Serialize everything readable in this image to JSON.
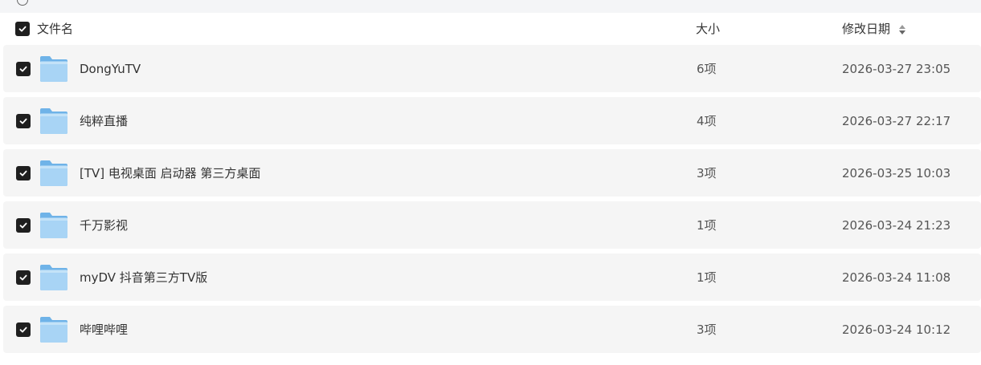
{
  "header": {
    "name_label": "文件名",
    "size_label": "大小",
    "date_label": "修改日期",
    "select_all_checked": true,
    "sort_icon": "sort-updown-icon"
  },
  "files": [
    {
      "name": "DongYuTV",
      "size": "6项",
      "modified": "2026-03-27 23:05",
      "checked": true,
      "icon": "folder-icon"
    },
    {
      "name": "纯粹直播",
      "size": "4项",
      "modified": "2026-03-27 22:17",
      "checked": true,
      "icon": "folder-icon"
    },
    {
      "name": "[TV] 电视桌面 启动器 第三方桌面",
      "size": "3项",
      "modified": "2026-03-25 10:03",
      "checked": true,
      "icon": "folder-icon"
    },
    {
      "name": "千万影视",
      "size": "1项",
      "modified": "2026-03-24 21:23",
      "checked": true,
      "icon": "folder-icon"
    },
    {
      "name": "myDV 抖音第三方TV版",
      "size": "1项",
      "modified": "2026-03-24 11:08",
      "checked": true,
      "icon": "folder-icon"
    },
    {
      "name": "哔哩哔哩",
      "size": "3项",
      "modified": "2026-03-24 10:12",
      "checked": true,
      "icon": "folder-icon"
    }
  ],
  "colors": {
    "row_bg": "#f5f5f5",
    "checkbox_bg": "#1f1f1f",
    "folder_light": "#a8d4f5",
    "folder_dark": "#6fb3e8"
  }
}
